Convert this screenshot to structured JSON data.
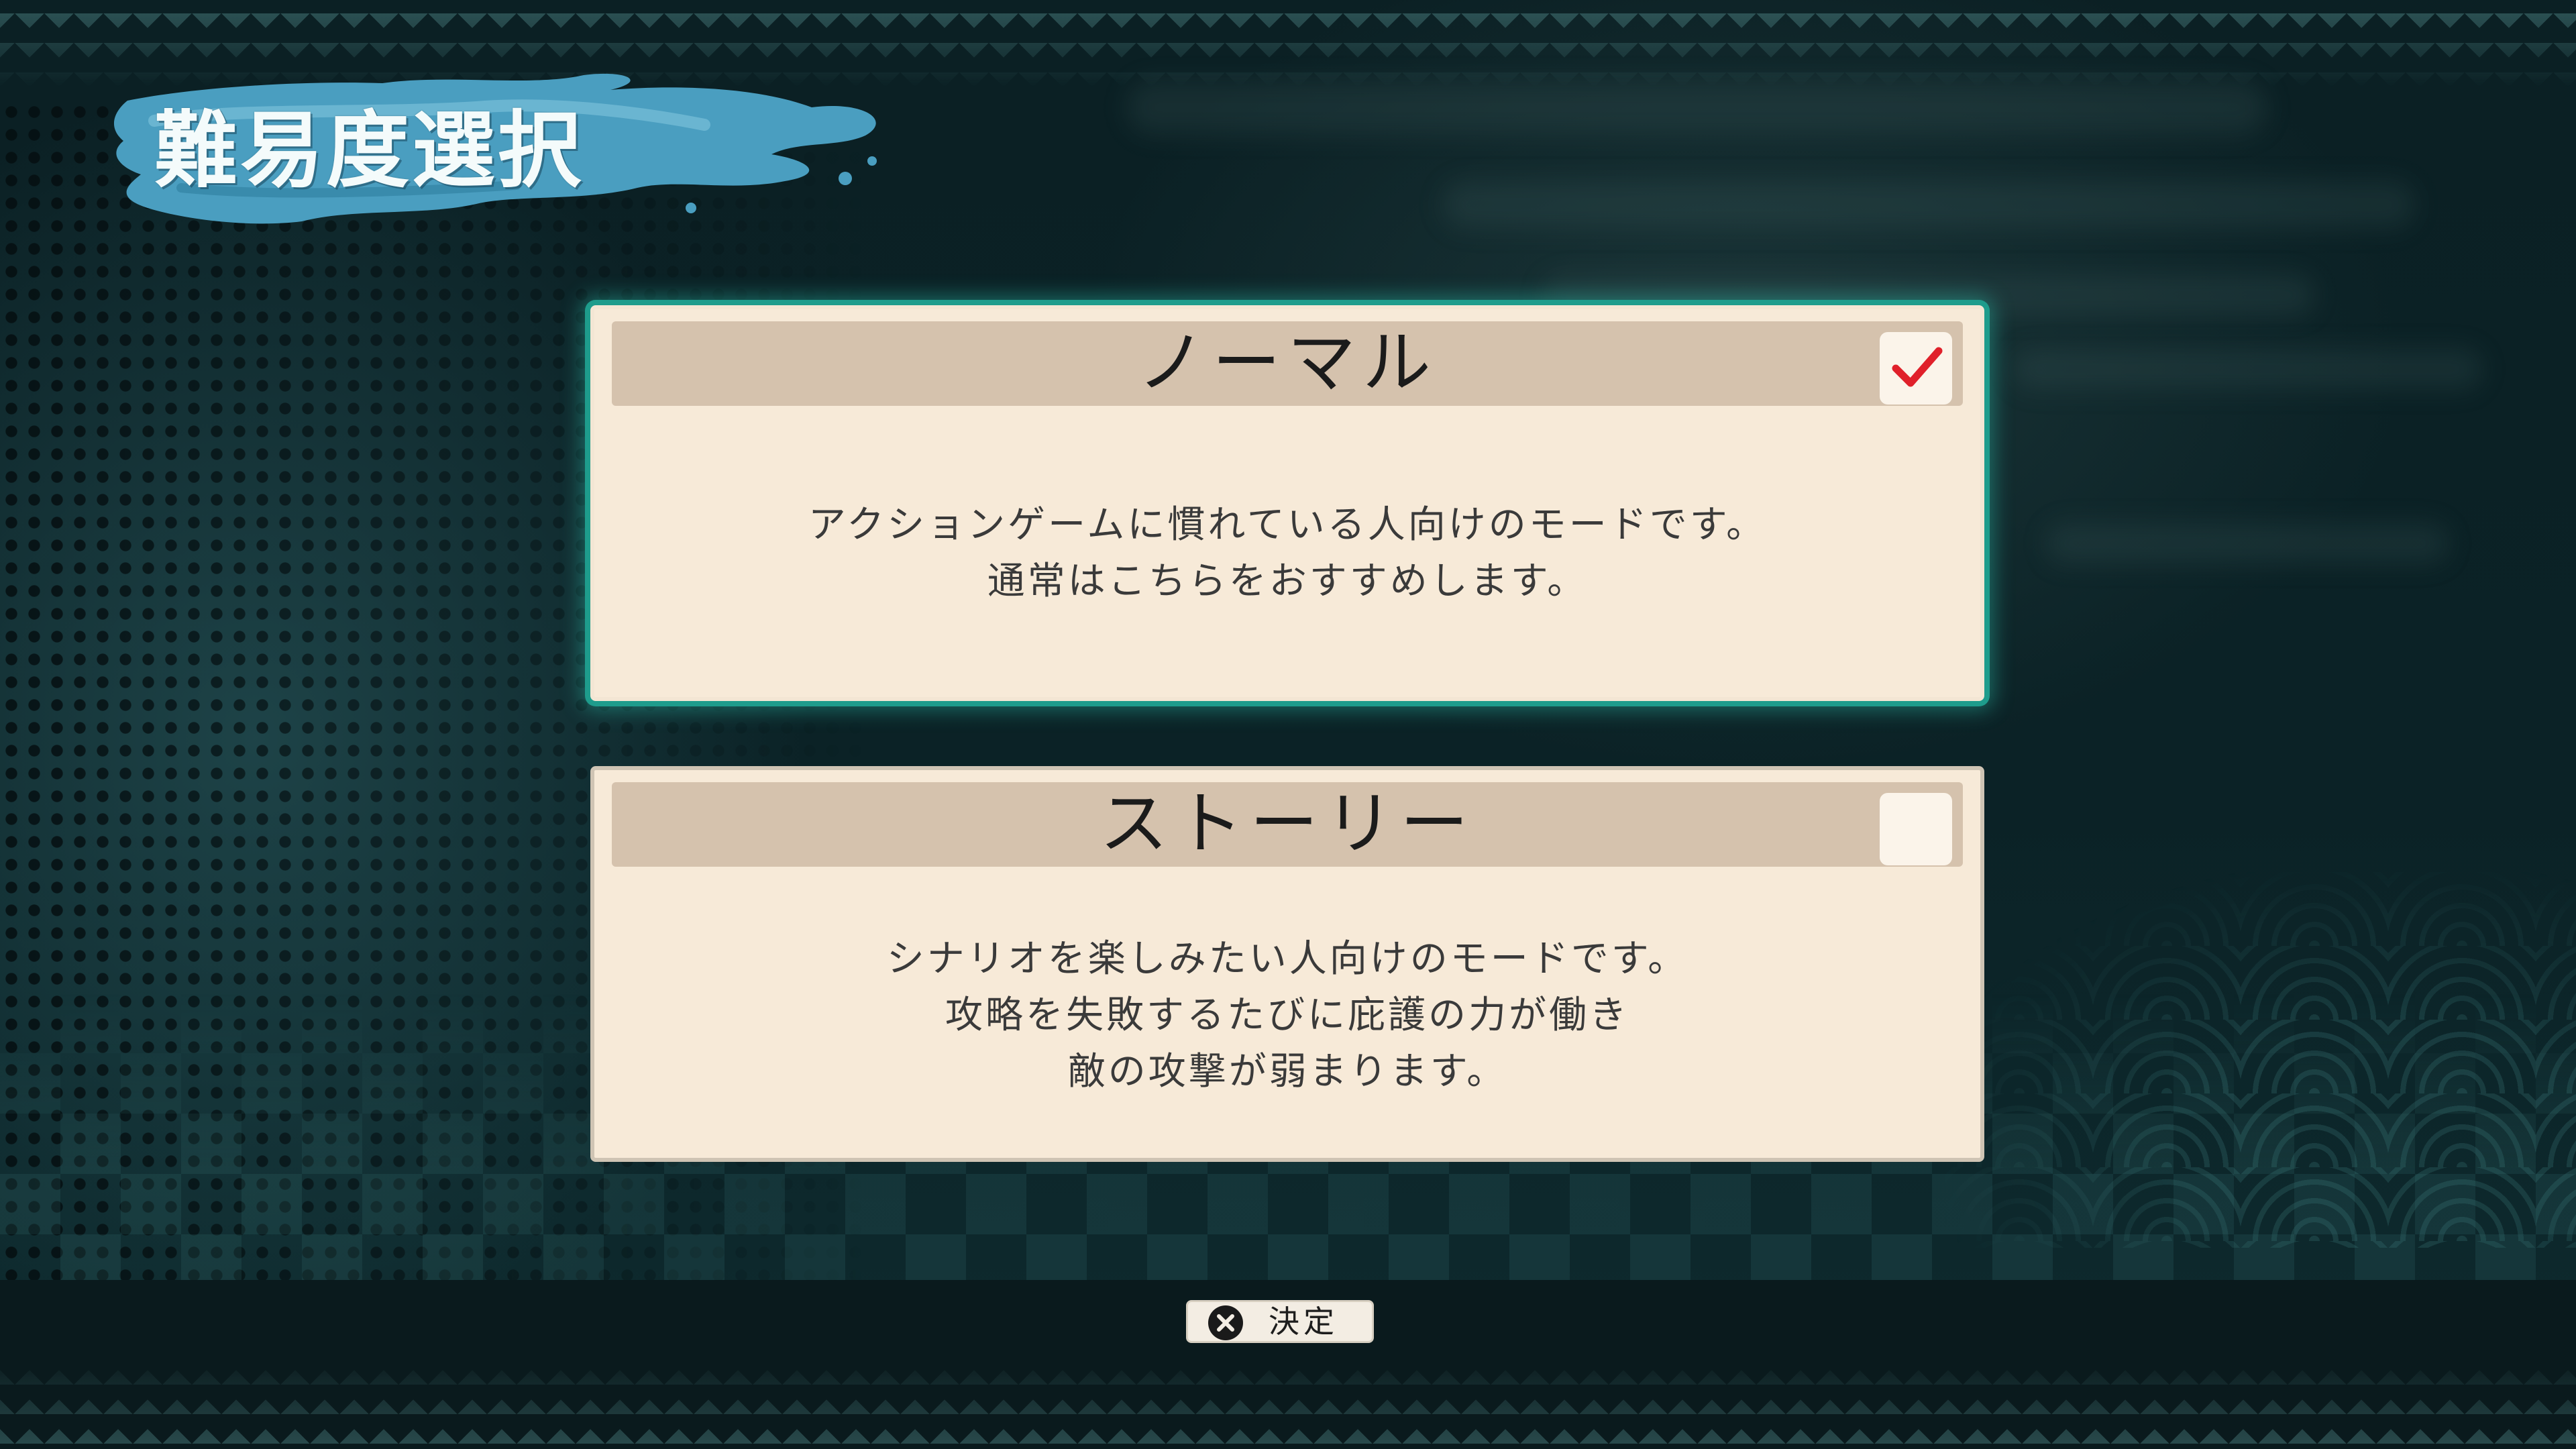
{
  "screen": {
    "title": "難易度選択"
  },
  "options": [
    {
      "name": "ノーマル",
      "selected": true,
      "description": [
        "アクションゲームに慣れている人向けのモードです。",
        "通常はこちらをおすすめします。"
      ]
    },
    {
      "name": "ストーリー",
      "selected": false,
      "description": [
        "シナリオを楽しみたい人向けのモードです。",
        "攻略を失敗するたびに庇護の力が働き",
        "敵の攻撃が弱まります。"
      ]
    }
  ],
  "footer": {
    "confirm_icon": "cross-button-icon",
    "confirm_label": "決定"
  },
  "colors": {
    "selection_glow": "#1e9c8c",
    "check_mark": "#e0202a",
    "card_background": "#f7ead8",
    "card_header": "#d5c2ad",
    "title_brush": "#4a9ec0"
  }
}
